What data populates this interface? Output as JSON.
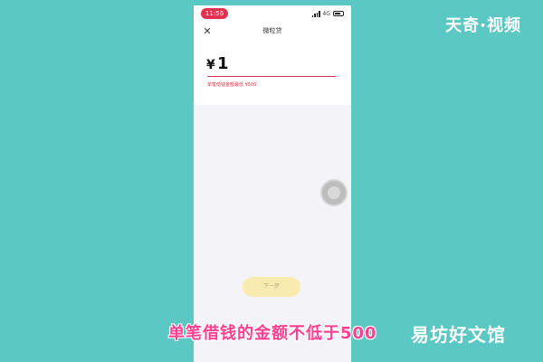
{
  "watermark": "天奇·视频",
  "status_bar": {
    "time": "11:56",
    "network": "4G"
  },
  "nav": {
    "close_icon": "close-icon",
    "title": "微粒贷"
  },
  "amount": {
    "currency_symbol": "¥",
    "value": "1",
    "hint": "单笔借钱金额最低 ¥500"
  },
  "next_button": "下一步",
  "caption": "单笔借钱的金额不低于500",
  "site_logo": "易坊好文馆",
  "colors": {
    "accent": "#e2304f",
    "background": "#5cc8c4",
    "button_disabled": "#f9ebb0"
  }
}
